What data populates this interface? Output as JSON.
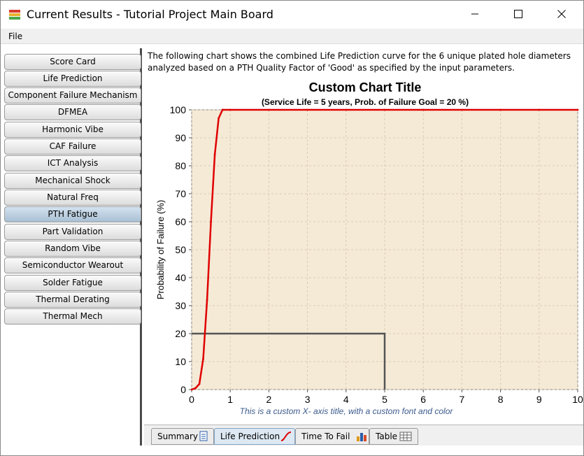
{
  "window": {
    "title": "Current Results - Tutorial Project Main Board",
    "minimize_icon": "minimize-icon",
    "maximize_icon": "maximize-icon",
    "close_icon": "close-icon"
  },
  "menu": {
    "file": "File"
  },
  "sidebar": {
    "items": [
      {
        "label": "Score Card",
        "active": false
      },
      {
        "label": "Life Prediction",
        "active": false
      },
      {
        "label": "Component Failure Mechanism",
        "active": false
      },
      {
        "label": "DFMEA",
        "active": false
      },
      {
        "label": "Harmonic Vibe",
        "active": false
      },
      {
        "label": "CAF Failure",
        "active": false
      },
      {
        "label": "ICT Analysis",
        "active": false
      },
      {
        "label": "Mechanical Shock",
        "active": false
      },
      {
        "label": "Natural Freq",
        "active": false
      },
      {
        "label": "PTH Fatigue",
        "active": true
      },
      {
        "label": "Part Validation",
        "active": false
      },
      {
        "label": "Random Vibe",
        "active": false
      },
      {
        "label": "Semiconductor Wearout",
        "active": false
      },
      {
        "label": "Solder Fatigue",
        "active": false
      },
      {
        "label": "Thermal Derating",
        "active": false
      },
      {
        "label": "Thermal Mech",
        "active": false
      }
    ]
  },
  "description": "The following chart shows the combined Life Prediction curve for  the 6 unique plated hole diameters analyzed based on a PTH Quality Factor of 'Good' as specified by the input parameters.",
  "tabs": [
    {
      "label": "Summary",
      "icon": "summary-document-icon",
      "active": false
    },
    {
      "label": "Life Prediction",
      "icon": "curve-icon",
      "active": true
    },
    {
      "label": "Time To Fail",
      "icon": "bar-chart-icon",
      "active": false
    },
    {
      "label": "Table",
      "icon": "table-grid-icon",
      "active": false
    }
  ],
  "colors": {
    "plot_background": "#f5ead6",
    "curve": "#e00000",
    "goal_line": "#555555",
    "xlabel": "#3b5a8c",
    "active_sidebar": "#b7cadb"
  },
  "chart_data": {
    "type": "line",
    "title": "Custom Chart Title",
    "subtitle": "(Service Life = 5 years, Prob. of Failure Goal = 20 %)",
    "xlabel": "This is a custom X- axis title, with a custom font and color",
    "ylabel": "Probability of Failure (%)",
    "xlim": [
      0,
      10
    ],
    "ylim": [
      0,
      100
    ],
    "xticks": [
      "0",
      "1",
      "2",
      "3",
      "4",
      "5",
      "6",
      "7",
      "8",
      "9",
      "10"
    ],
    "yticks": [
      "0",
      "10",
      "20",
      "30",
      "40",
      "50",
      "60",
      "70",
      "80",
      "90",
      "100"
    ],
    "grid": true,
    "series": [
      {
        "x": [
          0,
          0.1,
          0.2,
          0.3,
          0.4,
          0.5,
          0.6,
          0.7,
          0.8,
          1,
          2,
          3,
          4,
          5,
          6,
          7,
          8,
          9,
          10
        ],
        "y": [
          0,
          0.5,
          2,
          11,
          32,
          60,
          84,
          97,
          100,
          100,
          100,
          100,
          100,
          100,
          100,
          100,
          100,
          100,
          100
        ]
      }
    ],
    "goal_line": {
      "x": [
        0,
        5,
        5
      ],
      "y": [
        20,
        20,
        0
      ]
    }
  }
}
